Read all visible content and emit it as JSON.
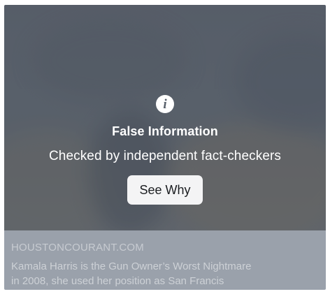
{
  "warning": {
    "icon": "info-icon",
    "icon_glyph": "i",
    "title": "False Information",
    "subtitle": "Checked by independent fact-checkers",
    "button_label": "See Why"
  },
  "link_preview": {
    "domain": "HOUSTONCOURANT.COM",
    "headline_line1": "Kamala Harris is the Gun Owner’s Worst Nightmare",
    "headline_line2": "in 2008, she used her position as San Francis"
  },
  "colors": {
    "overlay": "#656c77",
    "preview_bg": "#9aa1ab",
    "button_bg": "#f4f4f5"
  }
}
